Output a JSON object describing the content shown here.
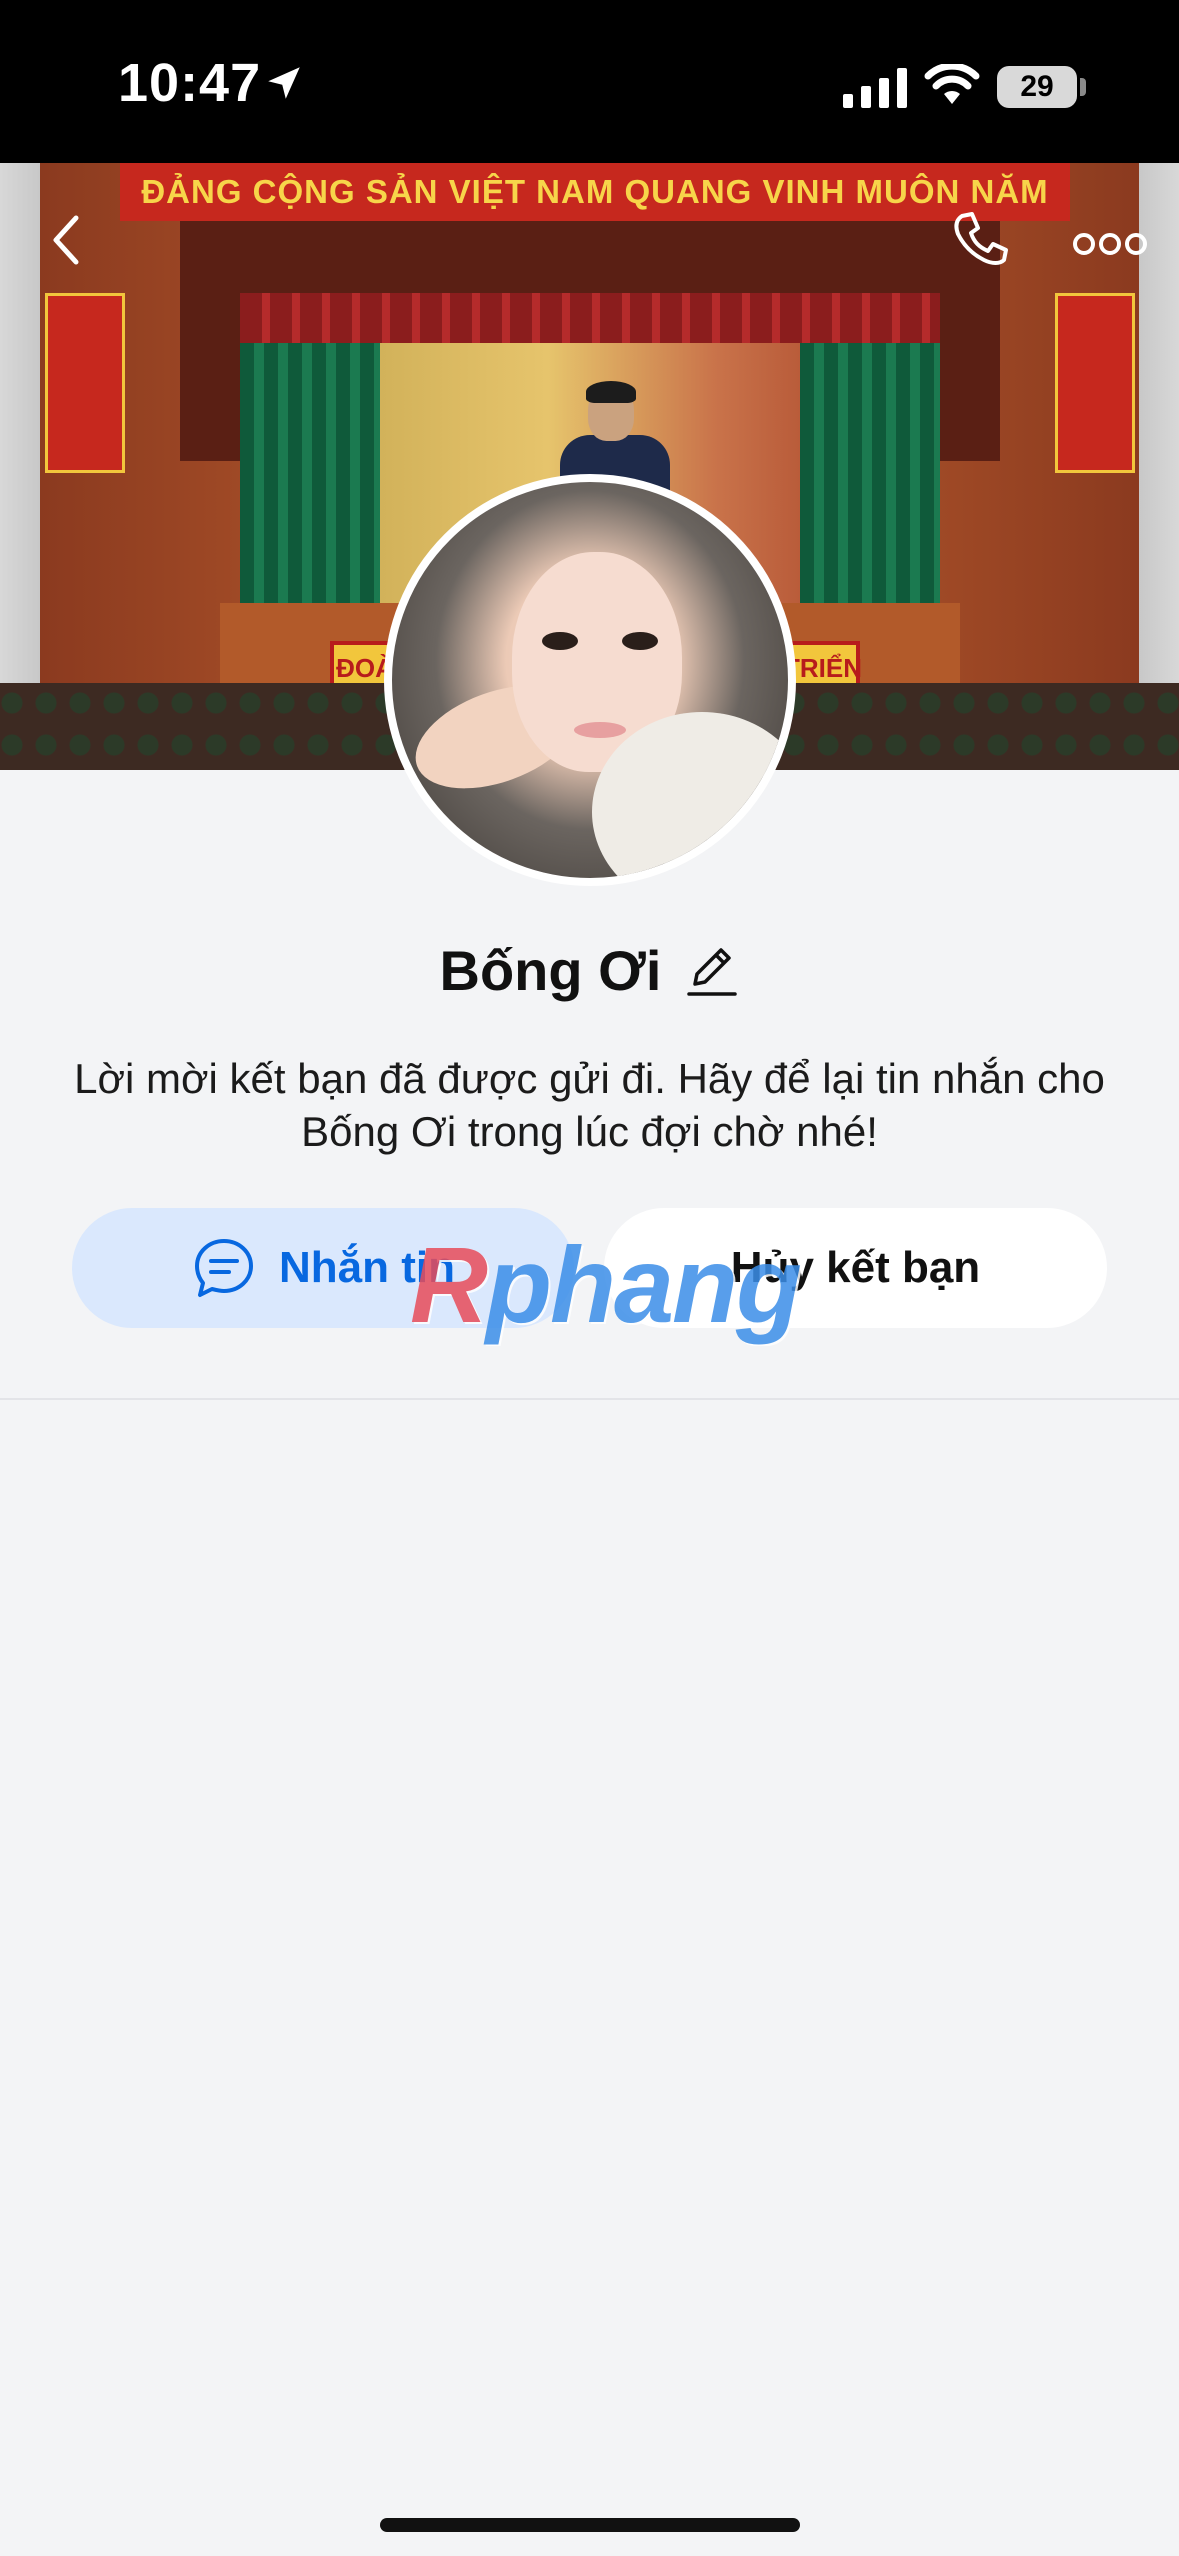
{
  "status_bar": {
    "time": "10:47",
    "battery": "29",
    "icons": [
      "location-arrow-icon",
      "cellular-signal-icon",
      "wifi-icon",
      "battery-icon"
    ]
  },
  "cover": {
    "banner_text": "ĐẢNG CỘNG SẢN VIỆT NAM QUANG VINH MUÔN NĂM",
    "stage_sign_left": "ĐOÀ",
    "stage_sign_right": "TRIỂN"
  },
  "header": {
    "icons": [
      "back-icon",
      "phone-icon",
      "more-icon"
    ]
  },
  "profile": {
    "name": "Bống Ơi",
    "message": "Lời mời kết bạn đã được gửi đi. Hãy để lại tin nhắn cho Bống Ơi trong lúc đợi chờ nhé!"
  },
  "actions": {
    "message_label": "Nhắn tin",
    "unfriend_label": "Hủy kết bạn"
  },
  "watermark": {
    "first_letter": "R",
    "rest": "phang"
  },
  "colors": {
    "primary": "#0868e0",
    "message_button_bg": "#dae8fd",
    "page_bg": "#f3f4f6"
  }
}
